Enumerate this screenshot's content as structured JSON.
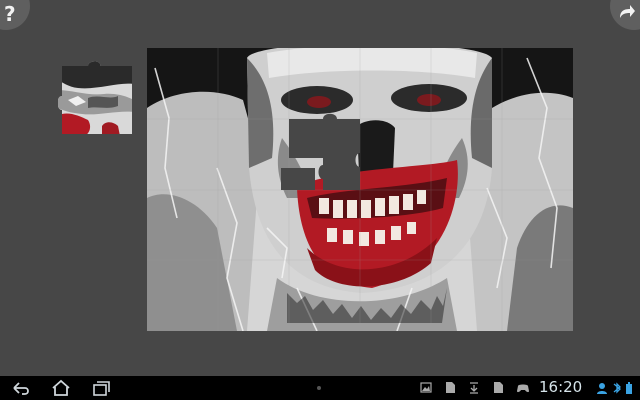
{
  "app": {
    "help_label": "?",
    "redo_icon": "redo-arrow-icon"
  },
  "puzzle": {
    "image_subject": "zombie-face-artwork",
    "missing_piece": "mouth-piece"
  },
  "system_bar": {
    "time": "16:20",
    "nav_icons": [
      "back-icon",
      "home-icon",
      "recent-apps-icon"
    ],
    "notification_icons": [
      "gallery-icon",
      "document-icon",
      "download-icon",
      "document-icon",
      "game-controller-icon"
    ],
    "status_icons": [
      "account-icon",
      "bluetooth-icon",
      "battery-icon"
    ]
  },
  "colors": {
    "background": "#474747",
    "board_dark": "#1c1c1c",
    "blood_red": "#b21a24"
  }
}
